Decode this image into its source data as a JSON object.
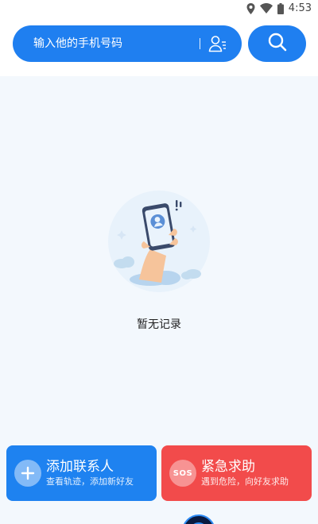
{
  "status_bar": {
    "time": "4:53",
    "icons": [
      "location-icon",
      "wifi-icon",
      "battery-icon"
    ]
  },
  "search": {
    "placeholder": "输入他的手机号码",
    "value": "",
    "contacts_icon": "contacts-book-icon",
    "search_icon": "search-icon"
  },
  "empty_state": {
    "message": "暂无记录",
    "illustration": "hand-holding-phone-illustration"
  },
  "actions": [
    {
      "title": "添加联系人",
      "subtitle": "查看轨迹，添加新好友",
      "icon": "plus-icon",
      "color": "#1e82f0"
    },
    {
      "title": "紧急求助",
      "subtitle": "遇到危险，向好友求助",
      "icon_label": "SOS",
      "color": "#f24b4b"
    }
  ],
  "colors": {
    "primary": "#1f7ff0",
    "danger": "#f24b4b",
    "background": "#f3f8fd"
  }
}
